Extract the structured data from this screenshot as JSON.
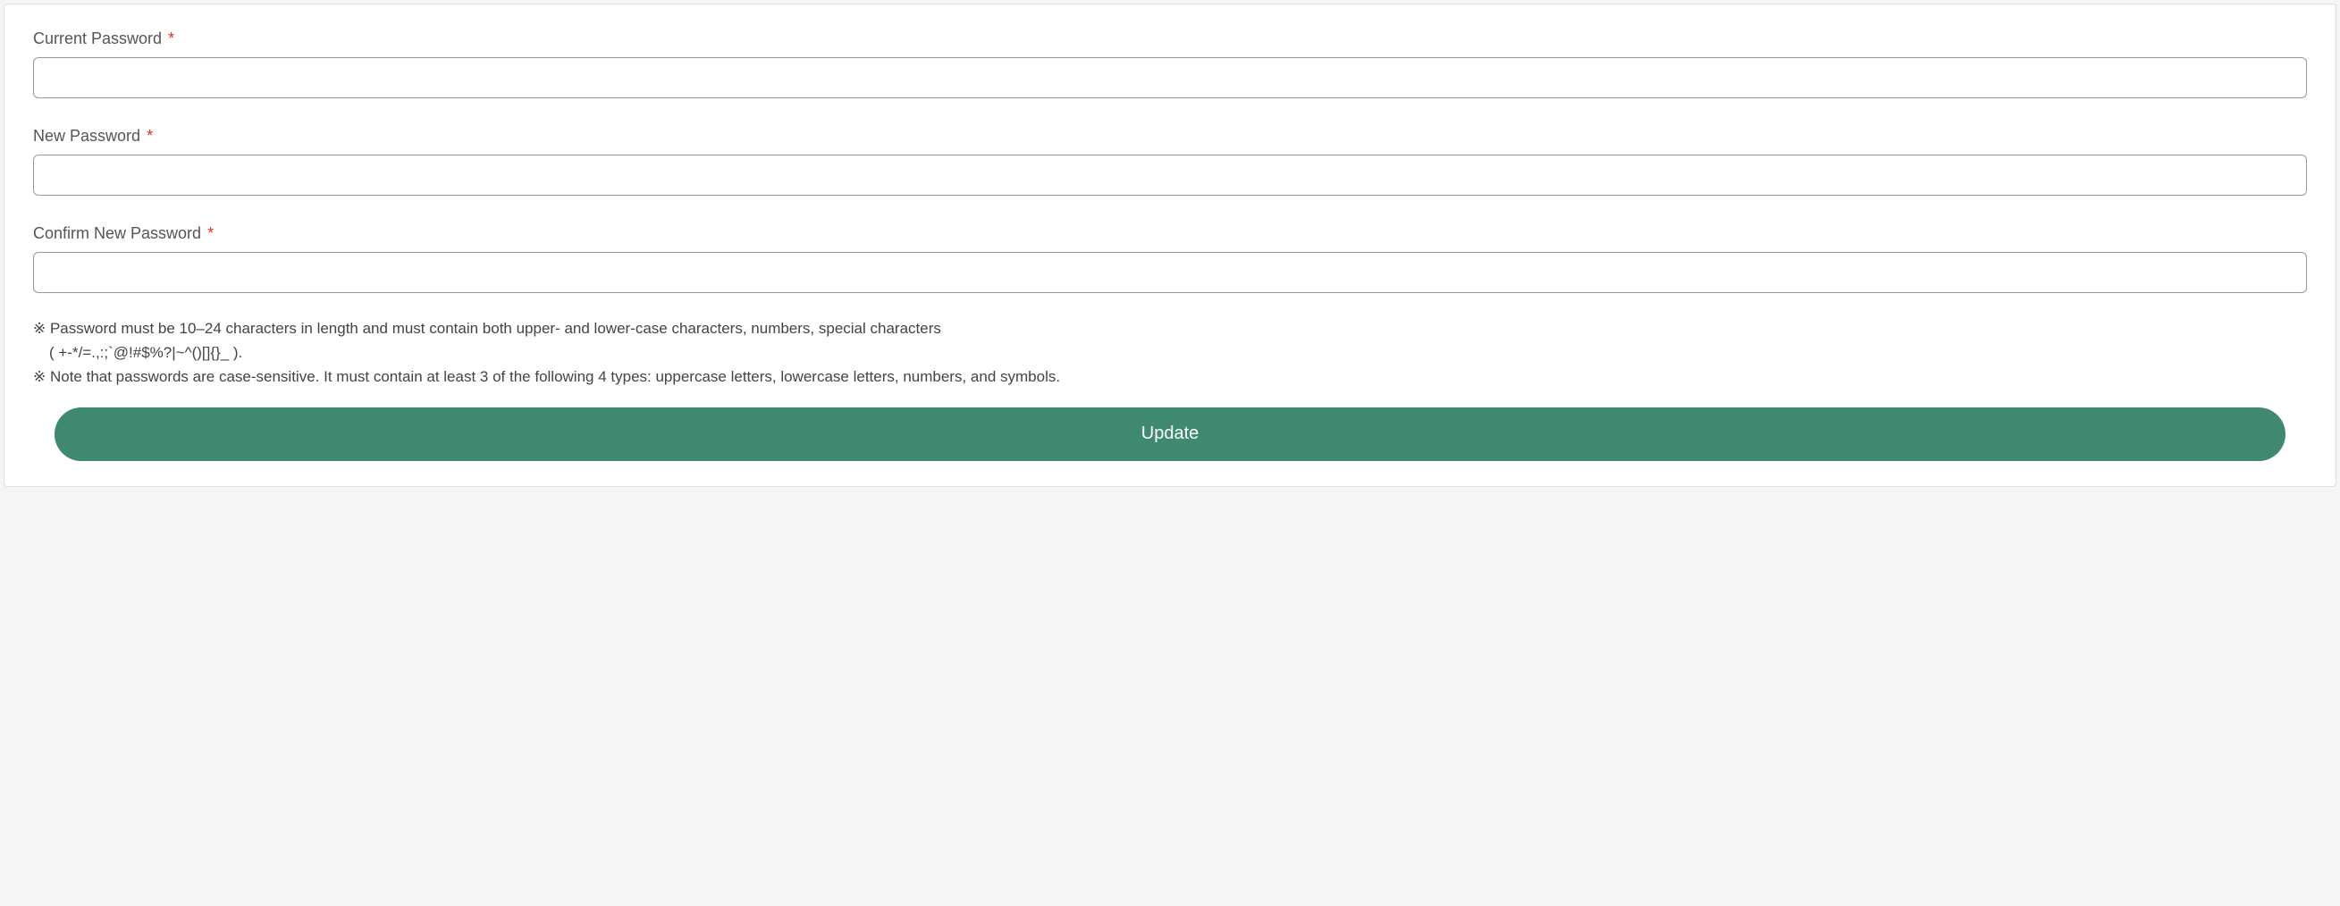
{
  "form": {
    "fields": {
      "current_password": {
        "label": "Current Password",
        "required_mark": "*",
        "value": ""
      },
      "new_password": {
        "label": "New Password",
        "required_mark": "*",
        "value": ""
      },
      "confirm_new_password": {
        "label": "Confirm New Password",
        "required_mark": "*",
        "value": ""
      }
    },
    "help": {
      "line1": "※ Password must be 10–24 characters in length and must contain both upper- and lower-case characters, numbers, special characters",
      "line1_cont": "( +-*/=.,:;`@!#$%?|~^()[]{}_ ).",
      "line2": "※ Note that passwords are case-sensitive. It must contain at least 3 of the following 4 types: uppercase letters, lowercase letters, numbers, and symbols."
    },
    "submit_label": "Update"
  }
}
